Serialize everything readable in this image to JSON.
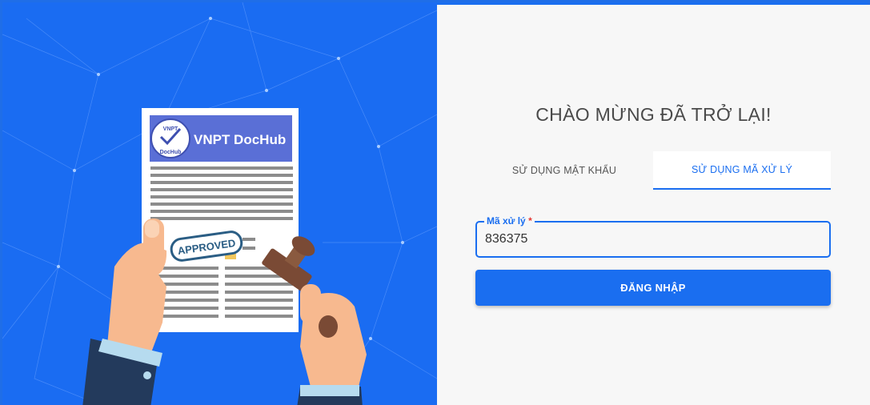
{
  "illustration": {
    "logo_text": "VNPT DocHub",
    "logo_badge_top": "VNPT",
    "logo_badge_bottom": "DocHub",
    "stamp_text": "APPROVED"
  },
  "login": {
    "title": "CHÀO MỪNG ĐÃ TRỞ LẠI!",
    "tabs": [
      {
        "label": "SỬ DỤNG MẬT KHẨU",
        "active": false
      },
      {
        "label": "SỬ DỤNG MÃ XỬ LÝ",
        "active": true
      }
    ],
    "code_field": {
      "label": "Mã xử lý",
      "required_mark": "*",
      "value": "836375"
    },
    "submit_label": "ĐĂNG NHẬP"
  },
  "colors": {
    "brand_blue": "#1a6ef0",
    "panel_bg": "#f7f7f7",
    "required_red": "#e53935"
  }
}
